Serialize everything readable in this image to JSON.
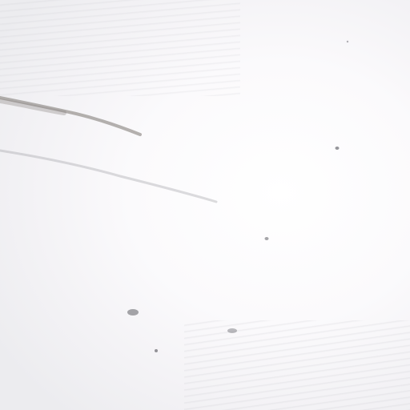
{
  "scene": {
    "description_tag": "",
    "background_color": "#f4f3f6",
    "mark_color": "#5a5a60"
  }
}
